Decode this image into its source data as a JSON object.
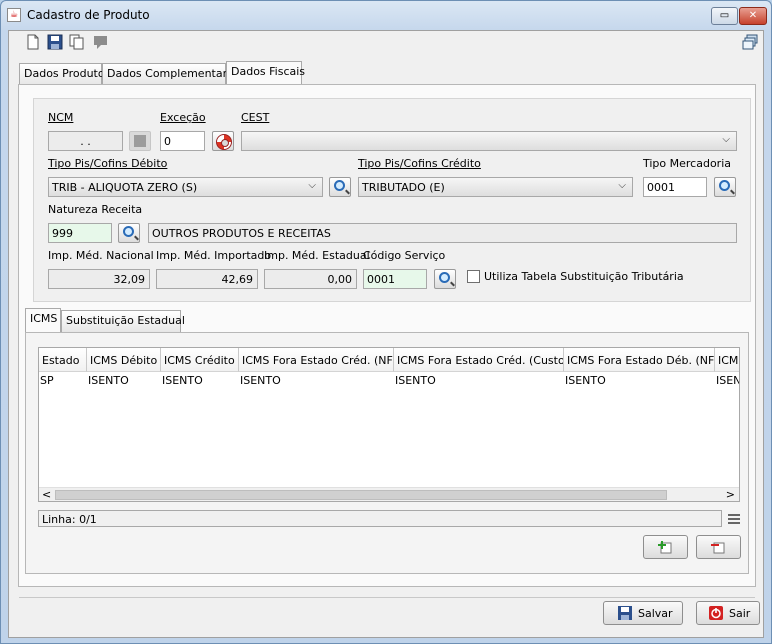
{
  "window": {
    "title": "Cadastro de Produto",
    "title_icon": "java-cup-icon",
    "controls": {
      "restore": "▭",
      "close": "✕"
    }
  },
  "toolbar": {
    "icons": [
      "new-document-icon",
      "save-disk-icon",
      "copy-documents-icon",
      "comment-icon"
    ],
    "right_icon": "windows-cascade-icon"
  },
  "main_tabs": [
    "Dados Produto",
    "Dados Complementares",
    "Dados Fiscais"
  ],
  "active_main_tab": "Dados Fiscais",
  "fiscal": {
    "ncm": {
      "label": "NCM",
      "value": ". ."
    },
    "excecao": {
      "label": "Exceção",
      "value": "0"
    },
    "cest": {
      "label": "CEST",
      "value": ""
    },
    "pis_debito": {
      "label": "Tipo Pis/Cofins Débito",
      "value": "TRIB - ALIQUOTA ZERO (S)"
    },
    "pis_credito": {
      "label": "Tipo Pis/Cofins Crédito",
      "value": "TRIBUTADO (E)"
    },
    "tipo_mercadoria": {
      "label": "Tipo Mercadoria",
      "value": "0001"
    },
    "natureza": {
      "label": "Natureza Receita",
      "code": "999",
      "description": "OUTROS PRODUTOS E RECEITAS"
    },
    "imp_nacional": {
      "label": "Imp. Méd. Nacional",
      "value": "32,09"
    },
    "imp_importado": {
      "label": "Imp. Méd. Importado",
      "value": "42,69"
    },
    "imp_estadual": {
      "label": "Imp. Méd. Estadual",
      "value": "0,00"
    },
    "codigo_servico": {
      "label": "Código Serviço",
      "value": "0001"
    },
    "substituicao_checkbox": {
      "label": "Utiliza Tabela Substituição Tributária",
      "checked": false
    }
  },
  "sub_tabs": [
    "ICMS",
    "Substituição Estadual"
  ],
  "active_sub_tab": "ICMS",
  "icms_table": {
    "columns": [
      "Estado",
      "ICMS Débito",
      "ICMS Crédito",
      "ICMS Fora Estado Créd. (NF)",
      "ICMS Fora Estado Créd. (Custo)",
      "ICMS Fora Estado Déb. (NF)",
      "ICMS"
    ],
    "rows": [
      [
        "SP",
        "ISENTO",
        "ISENTO",
        "ISENTO",
        "ISENTO",
        "ISENTO",
        "ISENTO"
      ]
    ],
    "status": "Linha: 0/1",
    "scroll_left": "<",
    "scroll_right": ">"
  },
  "table_buttons": {
    "add_icon": "add-row-icon",
    "remove_icon": "remove-row-icon",
    "menu_icon": "menu-lines-icon"
  },
  "footer": {
    "save_label": "Salvar",
    "exit_label": "Sair"
  },
  "colors": {
    "accent": "#2a6bb7",
    "green_field": "#e7f8ea",
    "danger": "#d32222"
  }
}
